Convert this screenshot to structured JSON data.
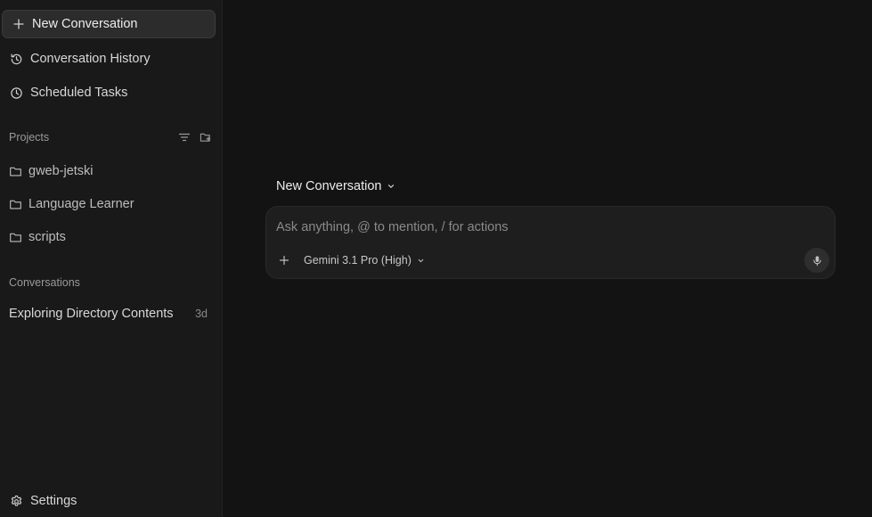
{
  "sidebar": {
    "new_conversation": {
      "label": "New Conversation",
      "icon": "plus-icon"
    },
    "nav": [
      {
        "label": "Conversation History",
        "icon": "history-icon"
      },
      {
        "label": "Scheduled Tasks",
        "icon": "clock-icon"
      }
    ],
    "projects": {
      "title": "Projects",
      "actions": [
        "filter-icon",
        "new-folder-icon"
      ],
      "items": [
        {
          "label": "gweb-jetski",
          "icon": "folder-icon"
        },
        {
          "label": "Language Learner",
          "icon": "folder-icon"
        },
        {
          "label": "scripts",
          "icon": "folder-icon"
        }
      ]
    },
    "conversations": {
      "title": "Conversations",
      "items": [
        {
          "label": "Exploring Directory Contents",
          "time": "3d"
        }
      ]
    },
    "settings": {
      "label": "Settings",
      "icon": "gear-icon"
    }
  },
  "main": {
    "conversation_title": "New Conversation",
    "composer": {
      "placeholder": "Ask anything, @ to mention, / for actions",
      "value": "",
      "model": "Gemini 3.1 Pro (High)",
      "mic_icon": "microphone-icon"
    }
  },
  "colors": {
    "background": "#131313",
    "sidebar": "#191919",
    "composer": "#1e1e1e",
    "button": "#2c2c2c"
  }
}
